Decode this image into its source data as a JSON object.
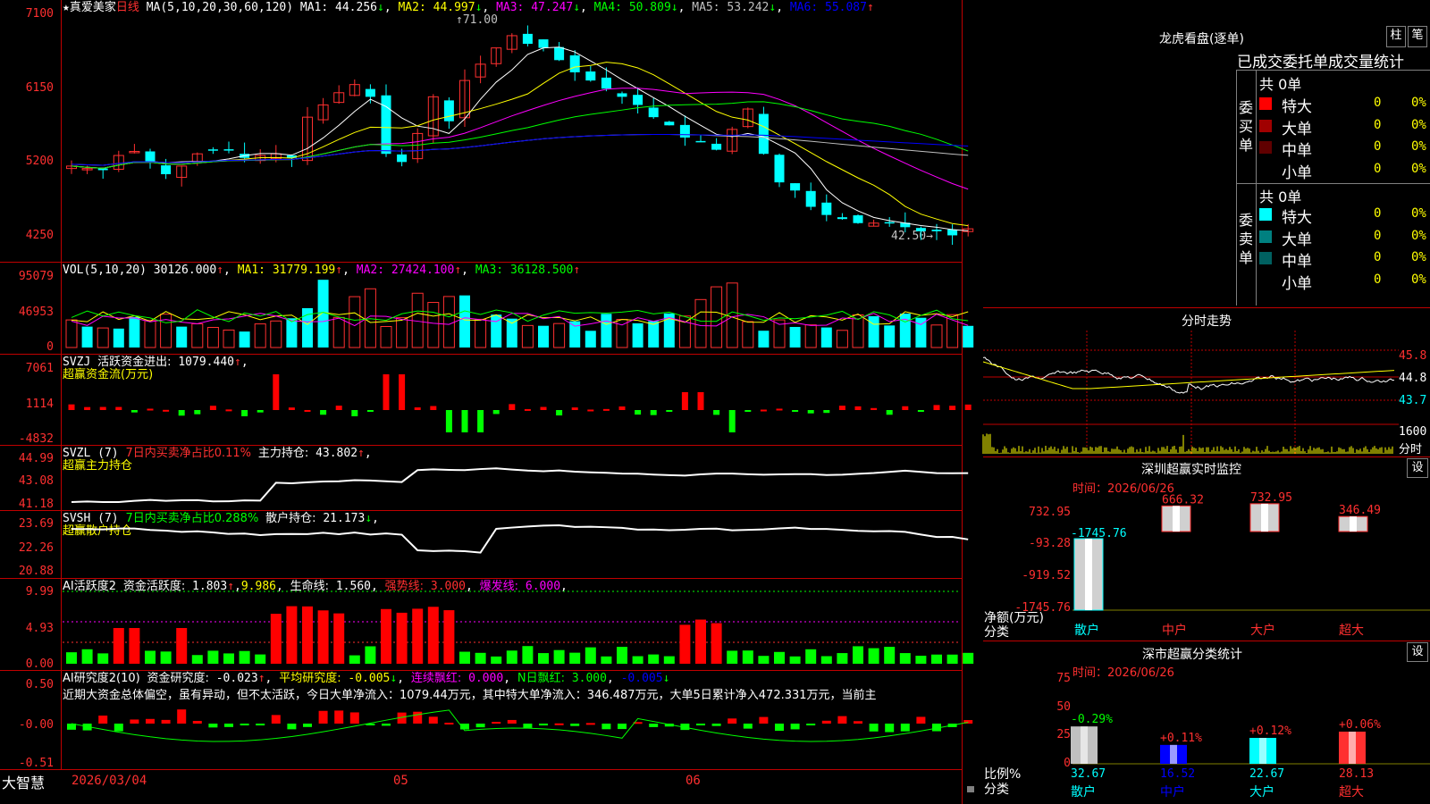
{
  "stock": {
    "name": "真爱美家",
    "period": "日线",
    "star": "★"
  },
  "ma_header": {
    "params": "MA(5,10,20,30,60,120)",
    "items": [
      {
        "label": "MA1:",
        "value": "44.256",
        "arrow": "↓",
        "color": "#ffffff"
      },
      {
        "label": "MA2:",
        "value": "44.997",
        "arrow": "↓",
        "color": "#ffff00"
      },
      {
        "label": "MA3:",
        "value": "47.247",
        "arrow": "↓",
        "color": "#ff00ff"
      },
      {
        "label": "MA4:",
        "value": "50.809",
        "arrow": "↓",
        "color": "#00ff00"
      },
      {
        "label": "MA5:",
        "value": "53.242",
        "arrow": "↓",
        "color": "#c0c0c0"
      },
      {
        "label": "MA6:",
        "value": "55.087",
        "arrow": "↑",
        "color": "#0000ff"
      }
    ]
  },
  "price_axis": [
    "7100",
    "6150",
    "5200",
    "4250"
  ],
  "price_annotations": {
    "high": "71.00",
    "low": "42.50"
  },
  "vol": {
    "params": "VOL(5,10,20)",
    "value": "30126.000",
    "arrow": "↑",
    "ma1": "MA1: 31779.199",
    "ma1_arrow": "↑",
    "ma2": "MA2: 27424.100",
    "ma2_arrow": "↑",
    "ma3": "MA3: 36128.500",
    "ma3_arrow": "↑",
    "axis": [
      "95079",
      "46953",
      "0"
    ]
  },
  "svzj": {
    "name": "SVZJ",
    "label": "活跃资金进出:",
    "value": "1079.440",
    "arrow": "↑",
    "sub": "超赢资金流(万元)",
    "axis": [
      "7061",
      "1114",
      "-4832"
    ]
  },
  "svzl": {
    "name": "SVZL (7)",
    "label": "7日内买卖净占比0.11%",
    "label2": "主力持仓:",
    "value": "43.802",
    "arrow": "↑",
    "sub": "超赢主力持仓",
    "axis": [
      "44.99",
      "43.08",
      "41.18"
    ]
  },
  "svsh": {
    "name": "SVSH (7)",
    "label": "7日内买卖净占比0.288%",
    "label2": "散户持仓:",
    "value": "21.173",
    "arrow": "↓",
    "sub": "超赢散户持仓",
    "axis": [
      "23.69",
      "22.26",
      "20.88"
    ]
  },
  "ai_act": {
    "name": "AI活跃度2",
    "label": "资金活跃度:",
    "value": "1.803",
    "arrow": "↑",
    "v2": "9.986",
    "label3": "生命线:",
    "v3": "1.560",
    "label4": "强势线:",
    "v4": "3.000",
    "label5": "爆发线:",
    "v5": "6.000",
    "axis": [
      "9.99",
      "4.93",
      "0.00"
    ]
  },
  "ai_res": {
    "name": "AI研究度2(10)",
    "label": "资金研究度:",
    "value": "-0.023",
    "arrow": "↑",
    "label2": "平均研究度:",
    "value2": "-0.005",
    "arrow2": "↓",
    "label3": "连续飘红:",
    "value3": "0.000",
    "label4": "N日飘红:",
    "value4": "3.000",
    "value5": "-0.005",
    "arrow5": "↓",
    "text": "近期大资金总体偏空，虽有异动，但不太活跃，今日大单净流入：1079.44万元，其中特大单净流入：346.487万元，大单5日累计净入472.331万元，当前主",
    "axis": [
      "0.50",
      "-0.00",
      "-0.51"
    ]
  },
  "date_axis": {
    "brand": "大智慧",
    "d1": "2026/03/04",
    "d2": "05",
    "d3": "06"
  },
  "dragon": {
    "title": "龙虎看盘(逐单)",
    "btn_bar": "柱",
    "btn_pen": "笔",
    "subtitle": "已成交委托单成交量统计",
    "buy_label": "委买单",
    "sell_label": "委卖单",
    "buy_total": "共 0单",
    "sell_total": "共 0单",
    "buy_rows": [
      {
        "label": "特大",
        "count": "0",
        "pct": "0%",
        "color": "#ff0000"
      },
      {
        "label": "大单",
        "count": "0",
        "pct": "0%",
        "color": "#a00000"
      },
      {
        "label": "中单",
        "count": "0",
        "pct": "0%",
        "color": "#600000"
      },
      {
        "label": "小单",
        "count": "0",
        "pct": "0%",
        "color": "#000000"
      }
    ],
    "sell_rows": [
      {
        "label": "特大",
        "count": "0",
        "pct": "0%",
        "color": "#00ffff"
      },
      {
        "label": "大单",
        "count": "0",
        "pct": "0%",
        "color": "#008080"
      },
      {
        "label": "中单",
        "count": "0",
        "pct": "0%",
        "color": "#006060"
      },
      {
        "label": "小单",
        "count": "0",
        "pct": "0%",
        "color": "#000000"
      }
    ]
  },
  "intraday": {
    "title": "分时走势",
    "axis": [
      "45.8",
      "44.8",
      "43.7"
    ],
    "vol_axis": "1600",
    "vol_unit": "分时"
  },
  "sz_monitor": {
    "title": "深圳超赢实时监控",
    "btn": "设",
    "time_label": "时间：2026/06/26",
    "axis": [
      "732.95",
      "-93.28",
      "-919.52",
      "-1745.76"
    ],
    "unit": "净额(万元)",
    "cat_label": "分类",
    "bars": [
      {
        "cat": "散户",
        "value": "-1745.76",
        "num": -1745.76
      },
      {
        "cat": "中户",
        "value": "666.32",
        "num": 666.32
      },
      {
        "cat": "大户",
        "value": "732.95",
        "num": 732.95
      },
      {
        "cat": "超大",
        "value": "346.49",
        "num": 346.49
      }
    ]
  },
  "sz_class": {
    "title": "深市超赢分类统计",
    "btn": "设",
    "time_label": "时间：2026/06/26",
    "axis": [
      "75",
      "50",
      "25",
      "0"
    ],
    "unit": "比例%",
    "cat_label": "分类",
    "bars": [
      {
        "cat": "散户",
        "value": "32.67",
        "change": "-0.29%",
        "num": 32.67,
        "color": "#c0c0c0",
        "change_color": "#00ff00"
      },
      {
        "cat": "中户",
        "value": "16.52",
        "change": "+0.11%",
        "num": 16.52,
        "color": "#0000ff",
        "change_color": "#ff3030"
      },
      {
        "cat": "大户",
        "value": "22.67",
        "change": "+0.12%",
        "num": 22.67,
        "color": "#00ffff",
        "change_color": "#ff3030"
      },
      {
        "cat": "超大",
        "value": "28.13",
        "change": "+0.06%",
        "num": 28.13,
        "color": "#ff3030",
        "change_color": "#ff3030"
      }
    ]
  }
}
